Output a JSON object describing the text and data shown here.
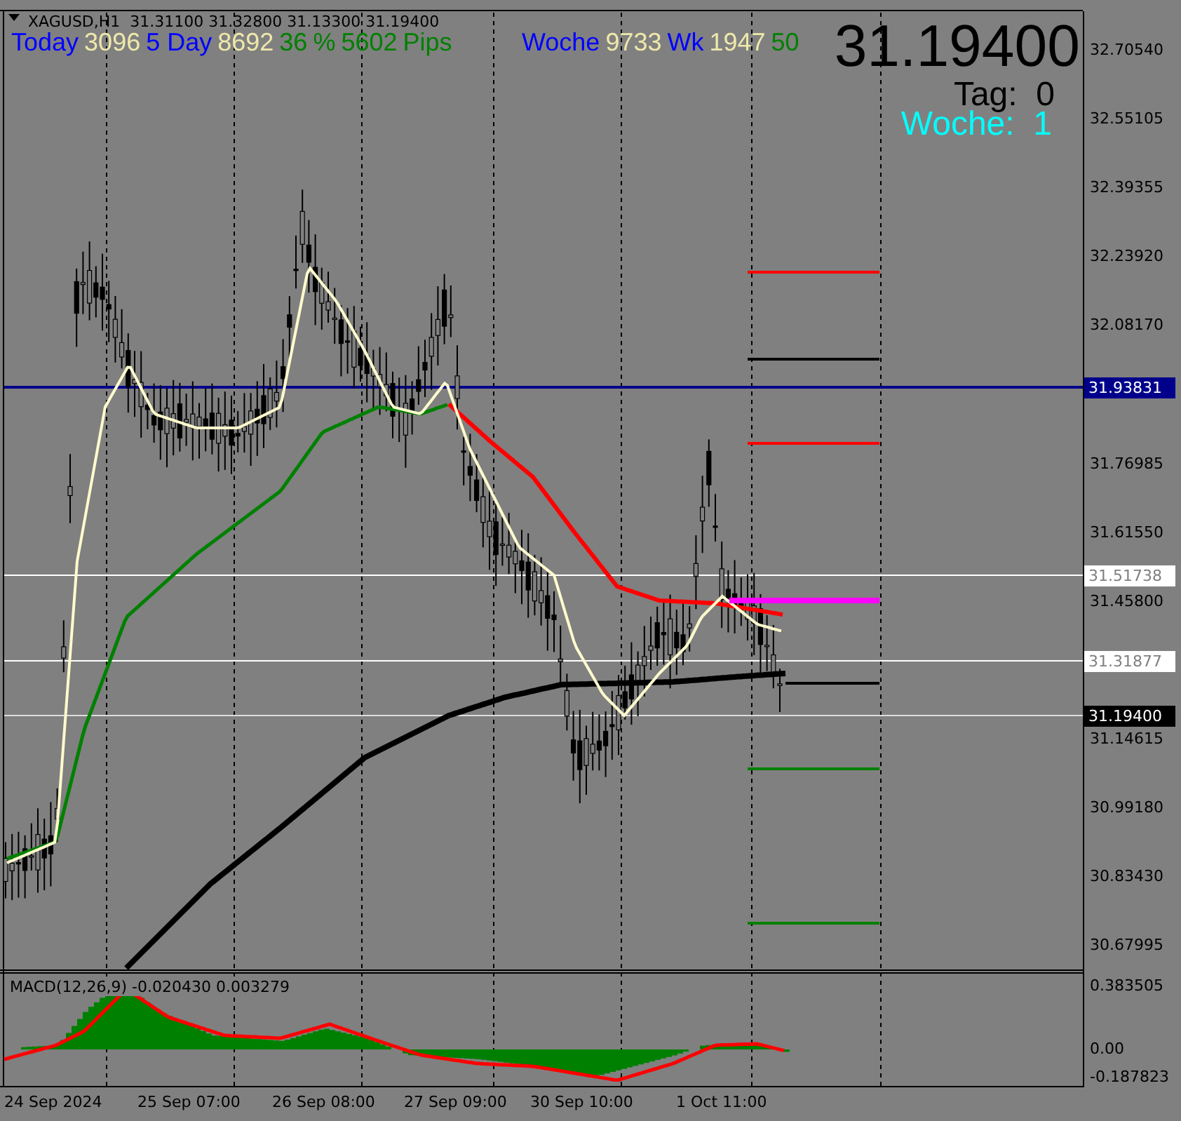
{
  "chart_header": {
    "symbol": "XAGUSD,H1",
    "quotes": "31.31100 31.32800 31.13300 31.19400"
  },
  "daily_stats": [
    {
      "kind": "label",
      "text": "Today"
    },
    {
      "kind": "value",
      "text": "3096"
    },
    {
      "kind": "label",
      "text": "5 Day"
    },
    {
      "kind": "value",
      "text": "8692"
    },
    {
      "kind": "result",
      "text": "36"
    },
    {
      "kind": "result",
      "text": "%"
    },
    {
      "kind": "result",
      "text": "5602"
    },
    {
      "kind": "result",
      "text": "Pips"
    }
  ],
  "weekly_stats": [
    {
      "kind": "label",
      "text": "Woche"
    },
    {
      "kind": "value",
      "text": "9733"
    },
    {
      "kind": "label",
      "text": "Wk"
    },
    {
      "kind": "value",
      "text": "1947"
    },
    {
      "kind": "result",
      "text": "50"
    }
  ],
  "current_price": "31.19400",
  "day_counter": "Tag:  0",
  "week_counter": "Woche:  1",
  "price_axis": [
    "32.70540",
    "32.55105",
    "32.39355",
    "32.23920",
    "32.08170",
    "31.76985",
    "31.61550",
    "31.45800",
    "31.14615",
    "30.99180",
    "30.83430",
    "30.67995"
  ],
  "price_markers": [
    {
      "kind": "blue",
      "text": "31.93831"
    },
    {
      "kind": "white",
      "text": "31.51738"
    },
    {
      "kind": "white",
      "text": "31.31877"
    },
    {
      "kind": "black",
      "text": "31.19400"
    }
  ],
  "macd": {
    "label": "MACD(12,26,9) -0.020430 0.003279",
    "axis": [
      "0.383505",
      "0.00",
      "-0.187823"
    ]
  },
  "time_axis": [
    "24 Sep 2024",
    "25 Sep 07:00",
    "26 Sep 08:00",
    "27 Sep 09:00",
    "30 Sep 10:00",
    "1 Oct 11:00"
  ]
}
